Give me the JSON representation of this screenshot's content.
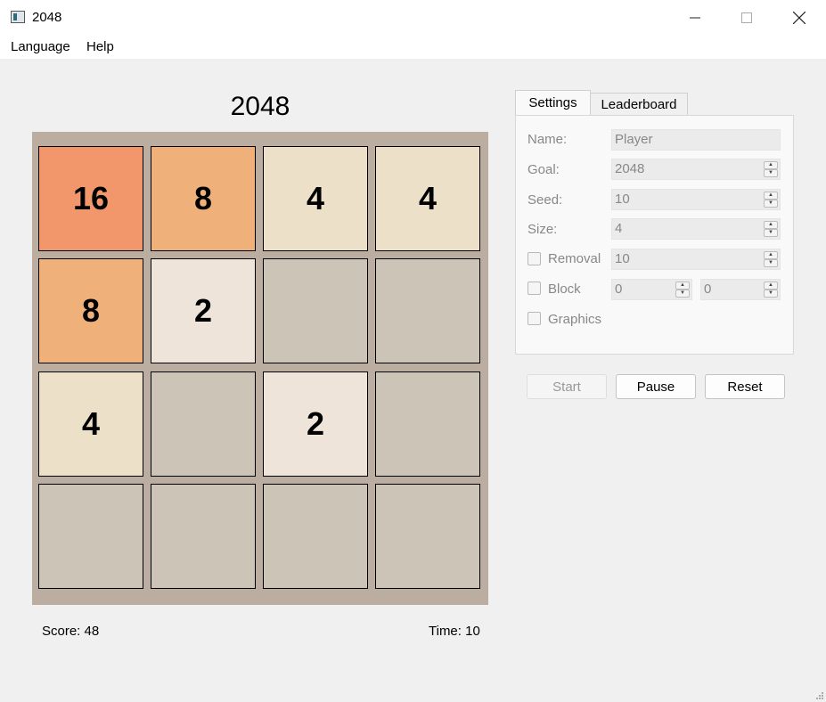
{
  "window": {
    "title": "2048"
  },
  "menu": {
    "items": [
      "Language",
      "Help"
    ]
  },
  "game": {
    "title": "2048",
    "score_text": "Score: 48",
    "time_text": "Time: 10",
    "grid": [
      [
        "16",
        "8",
        "4",
        "4"
      ],
      [
        "8",
        "2",
        "",
        ""
      ],
      [
        "4",
        "",
        "2",
        ""
      ],
      [
        "",
        "",
        "",
        ""
      ]
    ],
    "colors": {
      "board": "#bbada0",
      "empty": "#cbc4b7",
      "2": "#eee4da",
      "4": "#ede0c8",
      "8": "#f0b07a",
      "16": "#f2966b"
    }
  },
  "tabs": {
    "settings": "Settings",
    "leaderboard": "Leaderboard"
  },
  "settings": {
    "name_label": "Name:",
    "name_value": "Player",
    "goal_label": "Goal:",
    "goal_value": "2048",
    "seed_label": "Seed:",
    "seed_value": "10",
    "size_label": "Size:",
    "size_value": "4",
    "removal_label": "Removal",
    "removal_value": "10",
    "block_label": "Block",
    "block_value_1": "0",
    "block_value_2": "0",
    "graphics_label": "Graphics"
  },
  "buttons": {
    "start": "Start",
    "pause": "Pause",
    "reset": "Reset"
  }
}
